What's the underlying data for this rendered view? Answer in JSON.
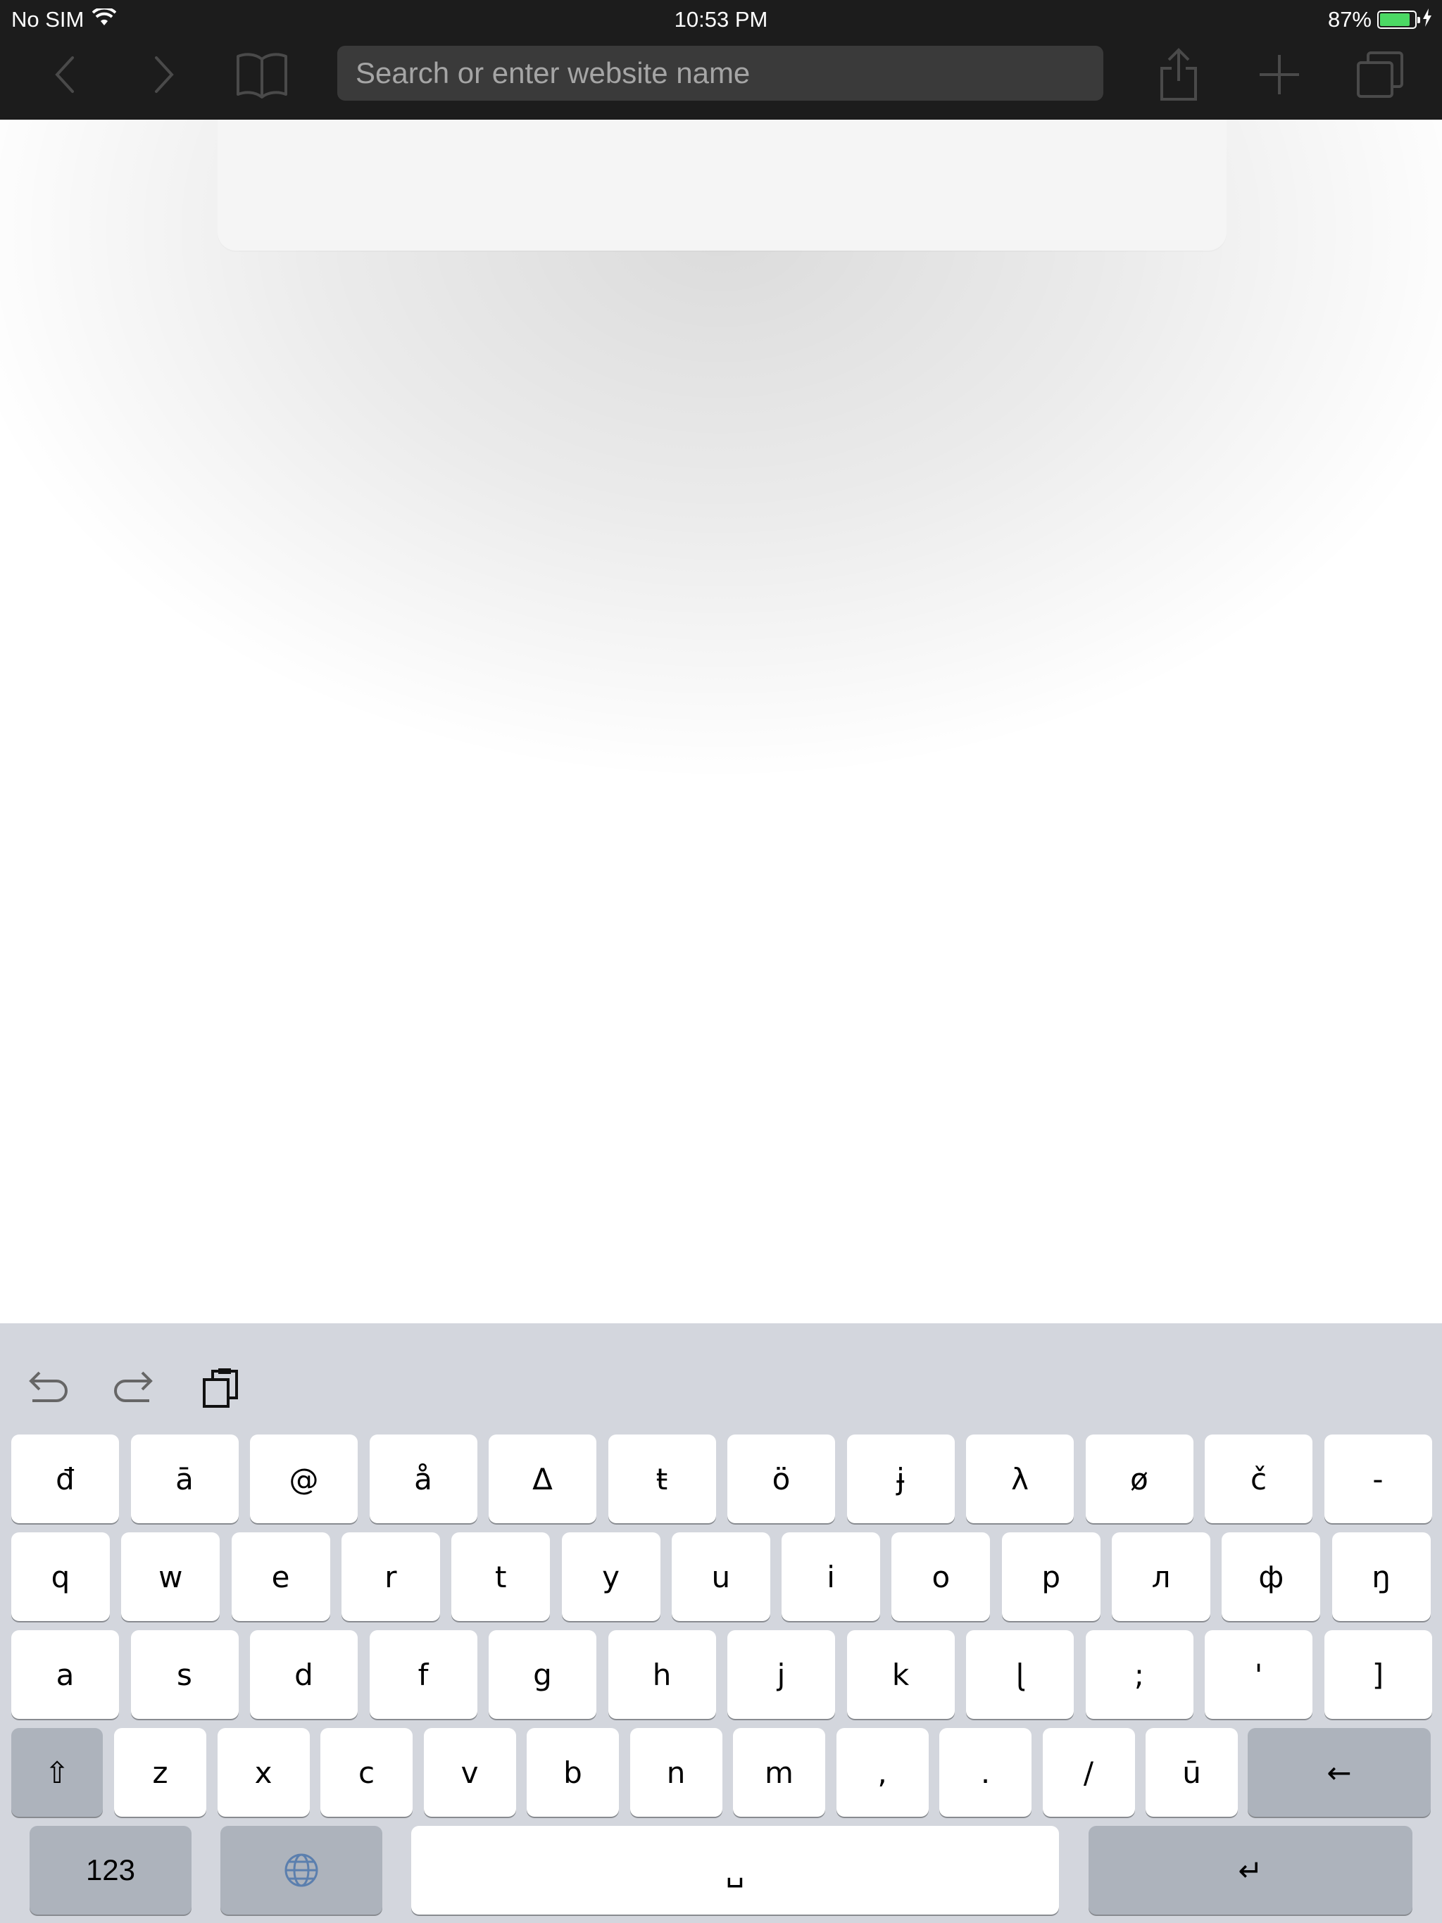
{
  "status_bar": {
    "carrier": "No SIM",
    "time": "10:53 PM",
    "battery": "87%",
    "battery_level": 0.87
  },
  "toolbar": {
    "back_icon": "chevron-left-icon",
    "forward_icon": "chevron-right-icon",
    "bookmarks_icon": "book-icon",
    "url_placeholder": "Search or enter website name",
    "url_value": "",
    "share_icon": "share-icon",
    "new_tab_icon": "plus-icon",
    "tabs_icon": "tabs-icon"
  },
  "keyboard": {
    "shortcuts": [
      "undo-icon",
      "redo-icon",
      "paste-icon"
    ],
    "row1": [
      "đ",
      "ā",
      "@",
      "å",
      "Δ",
      "ŧ",
      "ö",
      "ɉ",
      "λ",
      "ø",
      "č",
      "-"
    ],
    "row2": [
      "q",
      "w",
      "e",
      "r",
      "t",
      "y",
      "u",
      "i",
      "o",
      "p",
      "л",
      "ф",
      "ŋ"
    ],
    "row3": [
      "a",
      "s",
      "d",
      "f",
      "g",
      "h",
      "j",
      "k",
      "ɭ",
      ";",
      "'",
      "]"
    ],
    "row4": [
      "z",
      "x",
      "c",
      "v",
      "b",
      "n",
      "m",
      ",",
      ".",
      "/",
      "ū"
    ],
    "shift": "⇧",
    "backspace": "←",
    "numbers": "123",
    "globe_icon": "globe-icon",
    "space": "␣",
    "return": "↵"
  }
}
